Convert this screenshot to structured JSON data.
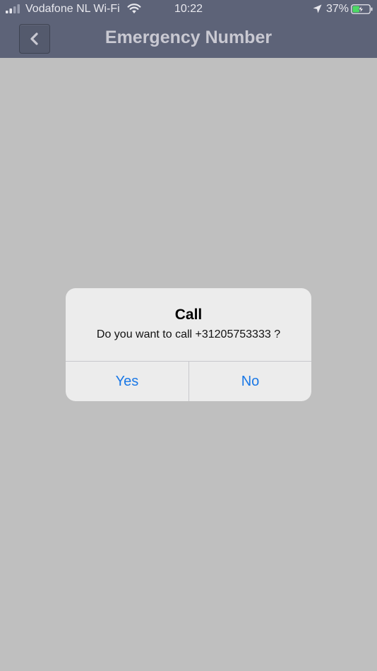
{
  "status_bar": {
    "carrier": "Vodafone NL Wi-Fi",
    "time": "10:22",
    "battery_percent": "37%",
    "icons": [
      "signal-icon",
      "wifi-icon",
      "location-arrow-icon",
      "battery-charging-icon"
    ]
  },
  "nav": {
    "title": "Emergency Number",
    "back_icon": "chevron-left-icon"
  },
  "alert": {
    "title": "Call",
    "message": "Do you want to call +31205753333 ?",
    "buttons": {
      "yes": "Yes",
      "no": "No"
    }
  },
  "colors": {
    "header_bg": "#5d6378",
    "backdrop": "#bfbfbf",
    "alert_bg": "#ececec",
    "action_blue": "#1a78e6",
    "battery_green": "#4cd964"
  }
}
